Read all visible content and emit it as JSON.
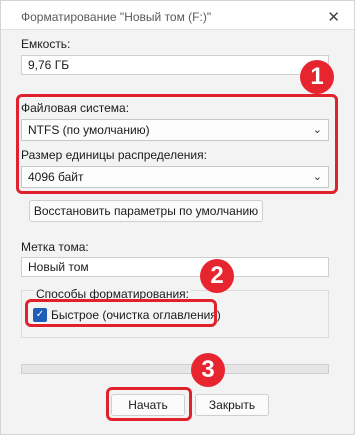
{
  "window": {
    "title": "Форматирование \"Новый том (F:)\"",
    "close_glyph": "✕"
  },
  "capacity": {
    "label": "Емкость:",
    "value": "9,76 ГБ"
  },
  "filesystem": {
    "label": "Файловая система:",
    "value": "NTFS (по умолчанию)"
  },
  "allocation": {
    "label": "Размер единицы распределения:",
    "value": "4096 байт"
  },
  "restore_defaults_label": "Восстановить параметры по умолчанию",
  "volume_label": {
    "label": "Метка тома:",
    "value": "Новый том"
  },
  "format_options": {
    "label": "Способы форматирования:",
    "quick_label": "Быстрое (очистка оглавления)",
    "quick_checked": true
  },
  "progress": 0,
  "buttons": {
    "start": "Начать",
    "close": "Закрыть"
  },
  "callouts": [
    "1",
    "2",
    "3"
  ],
  "colors": {
    "callout": "#e7252f",
    "checkbox": "#1d5fb8"
  }
}
